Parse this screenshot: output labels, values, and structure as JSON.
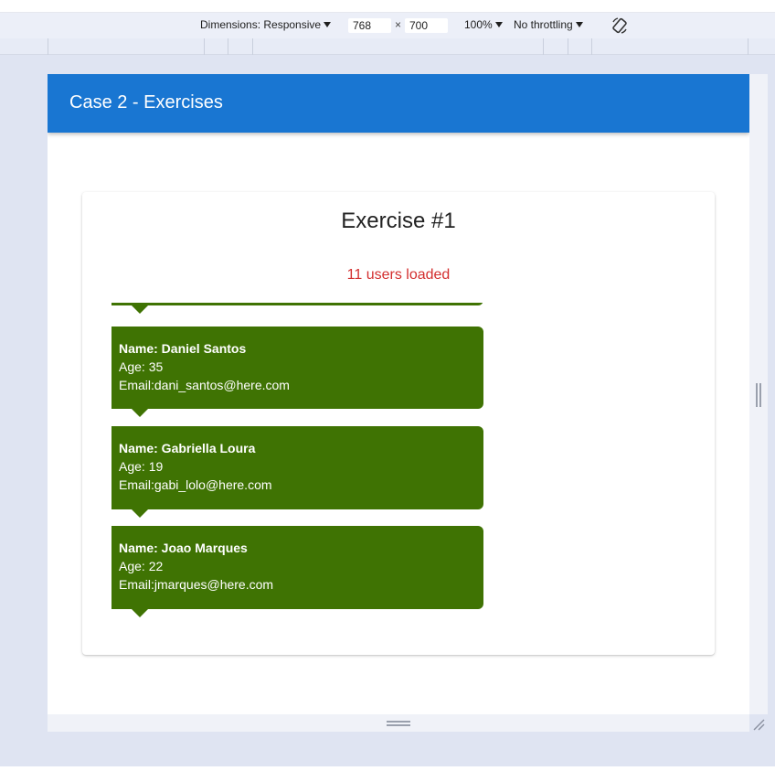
{
  "device_toolbar": {
    "dimensions_label": "Dimensions: Responsive",
    "width": "768",
    "times": "×",
    "height": "700",
    "zoom": "100%",
    "throttling": "No throttling"
  },
  "app": {
    "title": "Case 2 - Exercises"
  },
  "exercise": {
    "title": "Exercise #1",
    "status": "11 users loaded",
    "users": [
      {
        "name": "Name: Daniel Santos",
        "age": "Age: 35",
        "email": "Email:dani_santos@here.com"
      },
      {
        "name": "Name: Gabriella Loura",
        "age": "Age: 19",
        "email": "Email:gabi_lolo@here.com"
      },
      {
        "name": "Name: Joao Marques",
        "age": "Age: 22",
        "email": "Email:jmarques@here.com"
      }
    ]
  },
  "colors": {
    "appbar": "#1976d2",
    "bubble": "#3f7303",
    "status": "#d32f2f"
  }
}
